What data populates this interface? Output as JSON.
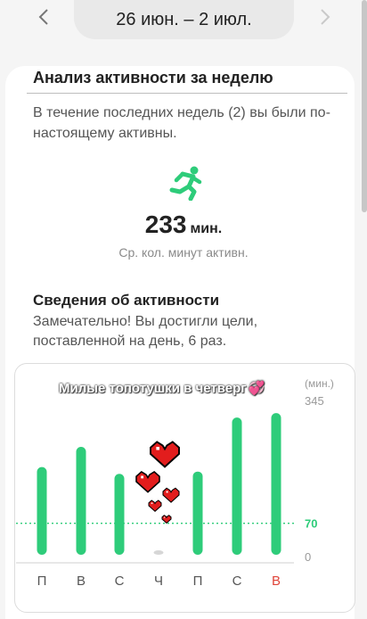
{
  "header": {
    "date_range": "26 июн. – 2 июл.",
    "prev_icon": "chevron-left-icon",
    "next_icon": "chevron-right-icon"
  },
  "weekly": {
    "title": "Анализ активности за неделю",
    "intro": "В течение последних недель (2) вы были по-настоящему активны.",
    "icon": "running-person-icon",
    "value": "233",
    "unit": "мин.",
    "caption": "Ср. кол. минут активн."
  },
  "details": {
    "title": "Сведения об активности",
    "text": "Замечательно! Вы достигли цели, поставленной на день, 6 раз."
  },
  "overlay": {
    "caption": "Милые топотушки в четверг"
  },
  "colors": {
    "accent": "#2ecc7a",
    "heart": "#e21d1d",
    "weekend_red": "#e0453a"
  },
  "chart_data": {
    "type": "bar",
    "categories": [
      "П",
      "В",
      "С",
      "Ч",
      "П",
      "С",
      "В"
    ],
    "values": [
      195,
      240,
      180,
      10,
      185,
      305,
      315
    ],
    "goal": 70,
    "goal_label": "70",
    "ylabel": "(мин.)",
    "ylim": [
      0,
      345
    ],
    "tick_labels": [
      "345",
      "0"
    ],
    "highlight_weekday_index": 6
  }
}
